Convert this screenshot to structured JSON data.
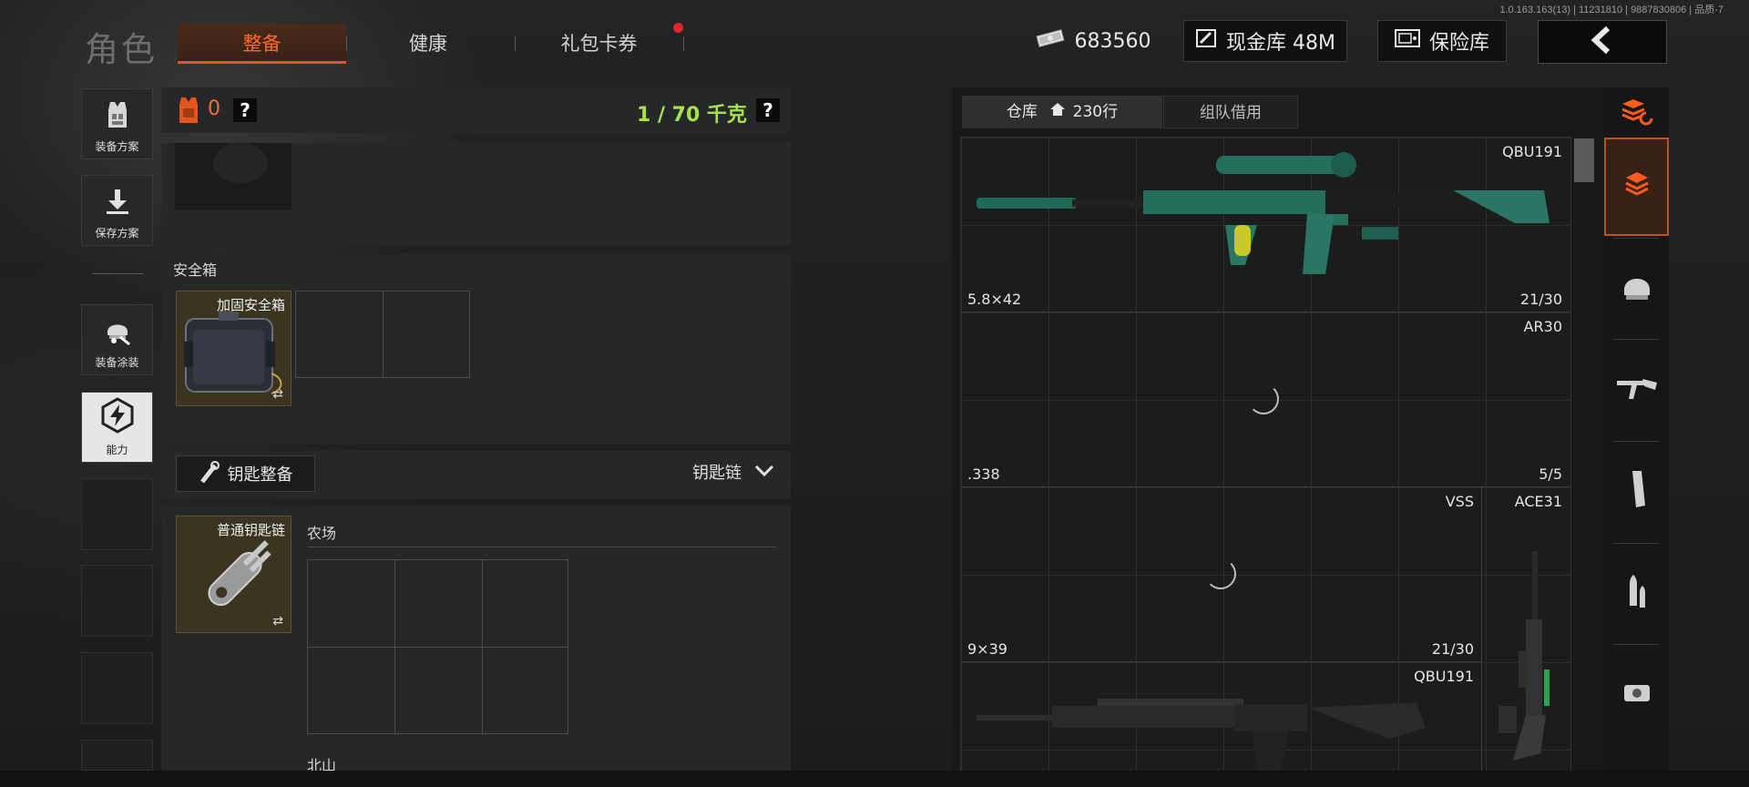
{
  "version_text": "1.0.163.163(13) | 11231810 | 9887830806 | 品质-7",
  "header": {
    "title": "角色",
    "tabs": [
      {
        "label": "整备",
        "active": true
      },
      {
        "label": "健康",
        "active": false
      },
      {
        "label": "礼包卡券",
        "active": false,
        "has_notification": true
      }
    ],
    "currency": {
      "icon": "cash-icon",
      "value": "683560"
    },
    "cash_vault": {
      "icon": "vault-icon",
      "label": "现金库 48M"
    },
    "insurance_vault": {
      "icon": "safe-icon",
      "label": "保险库"
    },
    "back_icon": "chevron-left-icon"
  },
  "sidebar": {
    "items": [
      {
        "label": "装备方案",
        "icon": "vest-icon"
      },
      {
        "label": "保存方案",
        "icon": "download-icon"
      },
      {
        "label": "装备涂装",
        "icon": "helmet-paint-icon"
      },
      {
        "label": "能力",
        "icon": "lightning-hex-icon",
        "selected": true
      }
    ]
  },
  "loadout": {
    "armor_count": "0",
    "help": "?",
    "weight": "1 / 70 千克",
    "weight_help": "?",
    "weight_color": "#a6e34a"
  },
  "safe_box": {
    "section_label": "安全箱",
    "item_name": "加固安全箱",
    "swap_icon": "⇄"
  },
  "key_loadout": {
    "button_label": "钥匙整备",
    "dropdown_label": "钥匙链",
    "key_item_name": "普通钥匙链",
    "swap_icon": "⇄",
    "maps": [
      "农场",
      "北山"
    ]
  },
  "warehouse": {
    "tabs": [
      {
        "label": "仓库",
        "extra": "230行",
        "active": true
      },
      {
        "label": "组队借用",
        "active": false
      }
    ],
    "items": [
      {
        "name": "QBU191",
        "caliber": "5.8×42",
        "ammo": "21/30"
      },
      {
        "name": "AR30",
        "caliber": ".338",
        "ammo": "5/5"
      },
      {
        "name": "VSS",
        "caliber": "9×39",
        "ammo": "21/30"
      },
      {
        "name": "ACE31",
        "caliber": "",
        "ammo": ""
      },
      {
        "name": "QBU191",
        "caliber": "",
        "ammo": ""
      }
    ]
  },
  "categories": [
    {
      "icon": "stack-refresh-icon"
    },
    {
      "icon": "all-items-icon",
      "active": true
    },
    {
      "icon": "helmet-icon"
    },
    {
      "icon": "rifle-icon"
    },
    {
      "icon": "magazine-icon"
    },
    {
      "icon": "bullets-icon"
    },
    {
      "icon": "sight-icon"
    }
  ],
  "colors": {
    "accent": "#e0561c",
    "accent_text": "#ff6a2a",
    "weight_ok": "#a6e34a"
  }
}
